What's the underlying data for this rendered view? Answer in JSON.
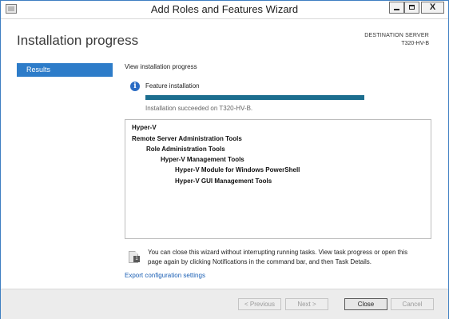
{
  "window": {
    "title": "Add Roles and Features Wizard",
    "icon": "wizard-app-icon",
    "close_glyph": "X"
  },
  "header": {
    "title": "Installation progress",
    "destination_label": "DESTINATION SERVER",
    "destination_server": "T320-HV-B"
  },
  "sidebar": {
    "items": [
      {
        "label": "Results",
        "selected": true
      }
    ]
  },
  "main": {
    "section_label": "View installation progress",
    "feature_label": "Feature installation",
    "info_icon_glyph": "i",
    "progress": 1.0,
    "status_text": "Installation succeeded on T320-HV-B.",
    "results": [
      {
        "text": "Hyper-V",
        "level": 0
      },
      {
        "text": "Remote Server Administration Tools",
        "level": 0
      },
      {
        "text": "Role Administration Tools",
        "level": 1
      },
      {
        "text": "Hyper-V Management Tools",
        "level": 2
      },
      {
        "text": "Hyper-V Module for Windows PowerShell",
        "level": 3
      },
      {
        "text": "Hyper-V GUI Management Tools",
        "level": 3
      }
    ],
    "note_icon_glyph": "1",
    "note_text": "You can close this wizard without interrupting running tasks. View task progress or open this page again by clicking Notifications in the command bar, and then Task Details.",
    "export_link": "Export configuration settings"
  },
  "footer": {
    "previous_label": "< Previous",
    "next_label": "Next >",
    "close_label": "Close",
    "cancel_label": "Cancel"
  },
  "colors": {
    "accent": "#2d7cc9",
    "progress": "#1c6e8f",
    "link": "#1a5fb4"
  }
}
